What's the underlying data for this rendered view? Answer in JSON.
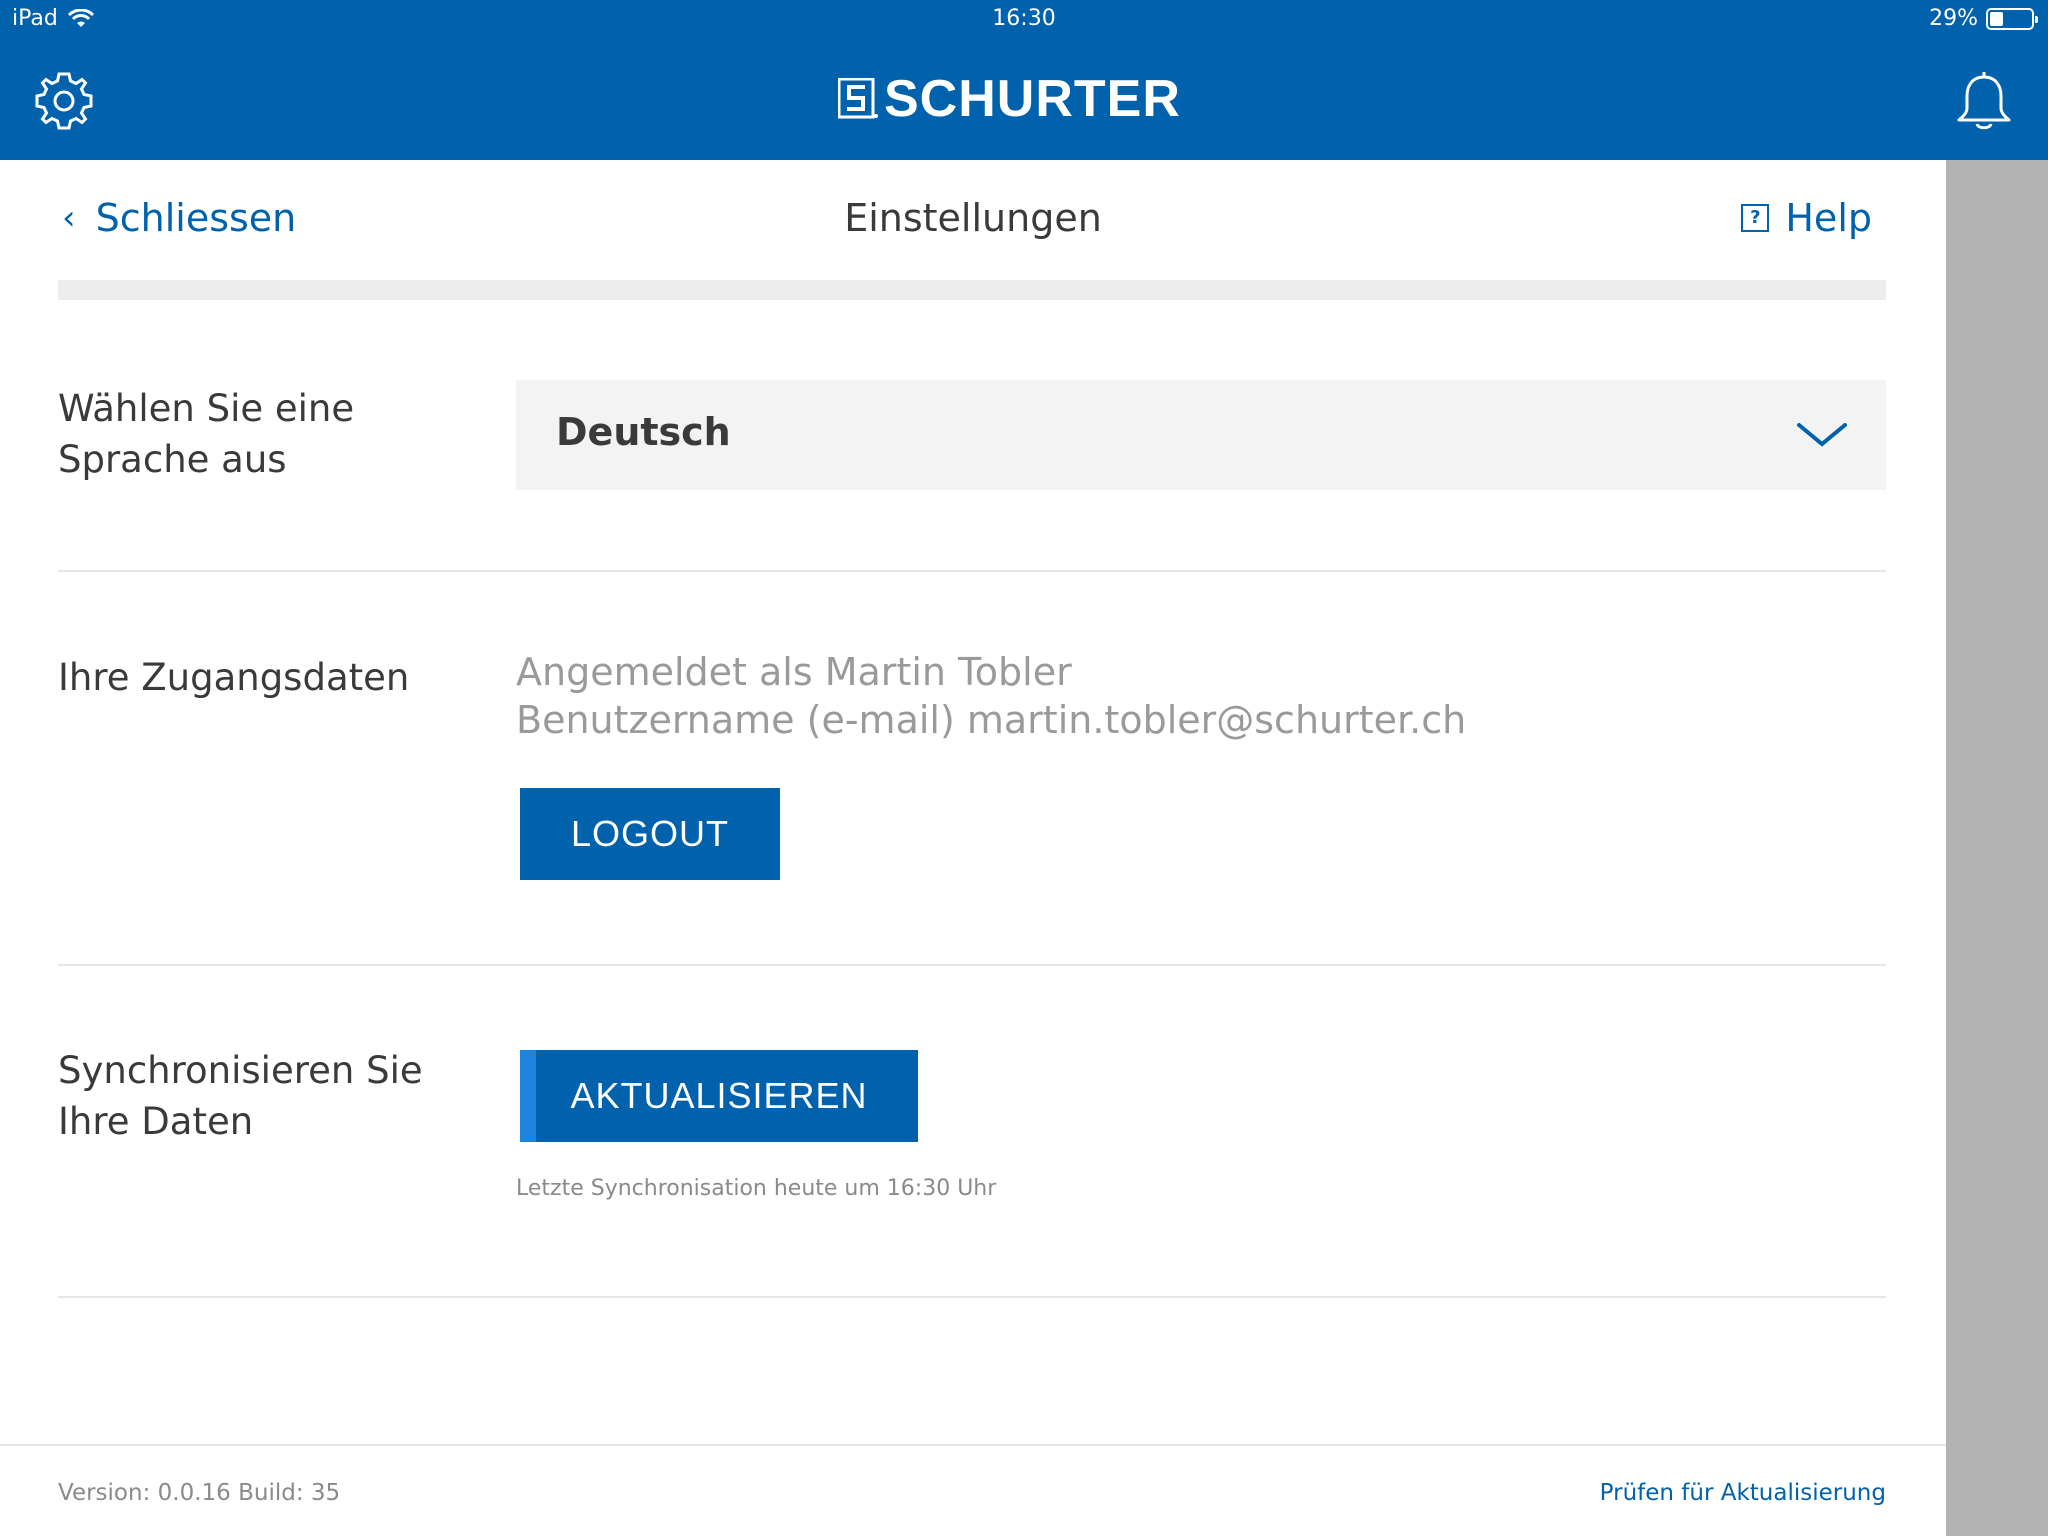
{
  "status_bar": {
    "device": "iPad",
    "time": "16:30",
    "battery": "29%",
    "battery_level": 0.29
  },
  "header": {
    "brand": "SCHURTER",
    "settings_icon": "gear-icon",
    "notifications_icon": "bell-icon",
    "color": "#0061ad"
  },
  "nav": {
    "back_label": "Schliessen",
    "title": "Einstellungen",
    "help_label": "Help",
    "help_icon_glyph": "?"
  },
  "language": {
    "label_line1": "Wählen Sie eine",
    "label_line2": "Sprache aus",
    "selected": "Deutsch"
  },
  "account": {
    "label": "Ihre Zugangsdaten",
    "logged_in_as": "Angemeldet als Martin Tobler",
    "username": "Benutzername (e-mail) martin.tobler@schurter.ch",
    "logout_label": "LOGOUT"
  },
  "sync": {
    "label_line1": "Synchronisieren Sie",
    "label_line2": "Ihre Daten",
    "button_label": "AKTUALISIEREN",
    "last_sync": "Letzte Synchronisation heute um 16:30 Uhr"
  },
  "footer": {
    "version": "Version: 0.0.16 Build: 35",
    "check_update": "Prüfen für Aktualisierung"
  }
}
